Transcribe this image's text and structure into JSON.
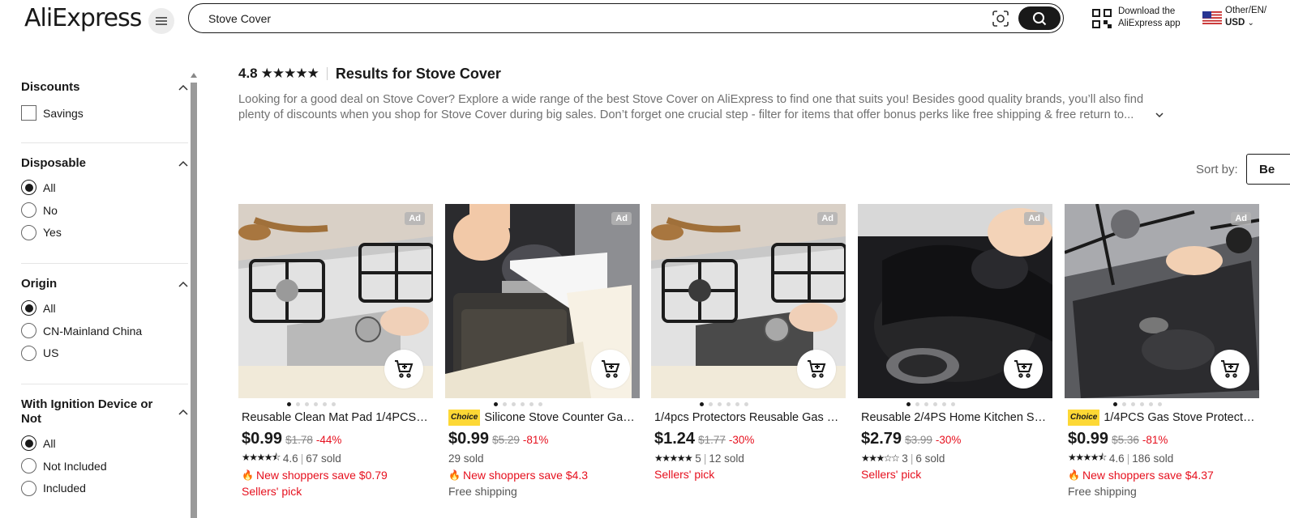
{
  "header": {
    "logo": "AliExpress",
    "search_value": "Stove Cover",
    "download_line1": "Download the",
    "download_line2": "AliExpress app",
    "lang_line1": "Other/EN/",
    "currency": "USD"
  },
  "sidebar": {
    "groups": [
      {
        "title": "Discounts",
        "type": "checkbox",
        "options": [
          {
            "label": "Savings",
            "selected": false
          }
        ]
      },
      {
        "title": "Disposable",
        "type": "radio",
        "options": [
          {
            "label": "All",
            "selected": true
          },
          {
            "label": "No",
            "selected": false
          },
          {
            "label": "Yes",
            "selected": false
          }
        ]
      },
      {
        "title": "Origin",
        "type": "radio",
        "options": [
          {
            "label": "All",
            "selected": true
          },
          {
            "label": "CN-Mainland China",
            "selected": false
          },
          {
            "label": "US",
            "selected": false
          }
        ]
      },
      {
        "title_line1": "With Ignition Device or",
        "title_line2": "Not",
        "type": "radio",
        "options": [
          {
            "label": "All",
            "selected": true
          },
          {
            "label": "Not Included",
            "selected": false
          },
          {
            "label": "Included",
            "selected": false
          }
        ]
      }
    ]
  },
  "main": {
    "rating": "4.8",
    "results_title": "Results for Stove Cover",
    "description_line1": "Looking for a good deal on Stove Cover? Explore a wide range of the best Stove Cover on AliExpress to find one that suits you! Besides good quality brands, you’ll also find",
    "description_line2": "plenty of discounts when you shop for Stove Cover during big sales. Don’t forget one crucial step - filter for items that offer bonus perks like free shipping & free return to...",
    "sort_label": "Sort by:",
    "sort_value": "Be"
  },
  "products": [
    {
      "title": "Reusable Clean Mat Pad 1/4PCS H...",
      "choice": false,
      "price": "$0.99",
      "original_price": "$1.78",
      "discount": "-44%",
      "rating": "4.6",
      "sold": "67 sold",
      "promo": "New shoppers save $0.79",
      "extra": "Sellers' pick",
      "extra_style": "red",
      "ad": "Ad",
      "stars": 4.5
    },
    {
      "title": "Silicone Stove Counter Gap ...",
      "choice": true,
      "choice_label": "Choice",
      "price": "$0.99",
      "original_price": "$5.29",
      "discount": "-81%",
      "rating": "",
      "sold": "29 sold",
      "promo": "New shoppers save $4.3",
      "extra": "Free shipping",
      "extra_style": "gray",
      "ad": "Ad",
      "stars": 0
    },
    {
      "title": "1/4pcs Protectors Reusable Gas St...",
      "choice": false,
      "price": "$1.24",
      "original_price": "$1.77",
      "discount": "-30%",
      "rating": "5",
      "sold": "12 sold",
      "promo": "",
      "extra": "Sellers' pick",
      "extra_style": "red",
      "ad": "Ad",
      "stars": 5
    },
    {
      "title": "Reusable 2/4PS Home Kitchen Stov...",
      "choice": false,
      "price": "$2.79",
      "original_price": "$3.99",
      "discount": "-30%",
      "rating": "3",
      "sold": "6 sold",
      "promo": "",
      "extra": "Sellers' pick",
      "extra_style": "red",
      "ad": "Ad",
      "stars": 3
    },
    {
      "title": "1/4PCS Gas Stove Protector ...",
      "choice": true,
      "choice_label": "Choice",
      "price": "$0.99",
      "original_price": "$5.36",
      "discount": "-81%",
      "rating": "4.6",
      "sold": "186 sold",
      "promo": "New shoppers save $4.37",
      "extra": "Free shipping",
      "extra_style": "gray",
      "ad": "Ad",
      "stars": 4.5
    }
  ]
}
